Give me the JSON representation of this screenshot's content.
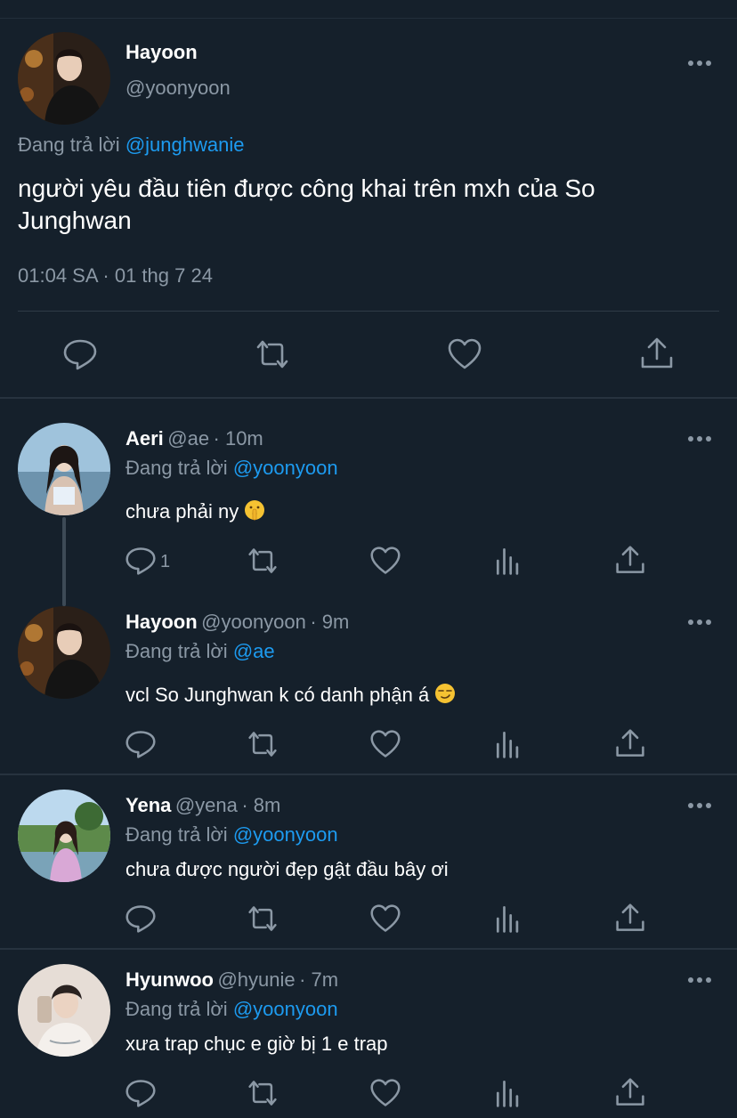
{
  "main_tweet": {
    "author_name": "Hayoon",
    "author_handle": "@yoonyoon",
    "reply_prefix": "Đang trả lời",
    "reply_to": "@junghwanie",
    "text_line1": "người yêu đầu tiên được công khai trên mxh của So",
    "text_line2": "Junghwan",
    "timestamp": "01:04 SA · 01 thg 7 24"
  },
  "replies": [
    {
      "name": "Aeri",
      "handle": "@ae",
      "time": "· 10m",
      "reply_prefix": "Đang trả lời",
      "reply_to": "@yoonyoon",
      "text": "chưa phải ny",
      "emoji": "shushing-face-emoji",
      "reply_count": "1"
    },
    {
      "name": "Hayoon",
      "handle": "@yoonyoon",
      "time": "· 9m",
      "reply_prefix": "Đang trả lời",
      "reply_to": "@ae",
      "text": "vcl So Junghwan k có danh phận á",
      "emoji": "smirking-face-emoji"
    },
    {
      "name": "Yena",
      "handle": "@yena",
      "time": "· 8m",
      "reply_prefix": "Đang trả lời",
      "reply_to": "@yoonyoon",
      "text": "chưa được người đẹp gật đầu bây ơi"
    },
    {
      "name": "Hyunwoo",
      "handle": "@hyunie",
      "time": "· 7m",
      "reply_prefix": "Đang trả lời",
      "reply_to": "@yoonyoon",
      "text": "xưa trap chục e giờ bị 1 e trap"
    }
  ],
  "colors": {
    "background": "#15202b",
    "accent": "#1d9bf0",
    "muted": "#8b98a5",
    "separator": "#27333f"
  }
}
